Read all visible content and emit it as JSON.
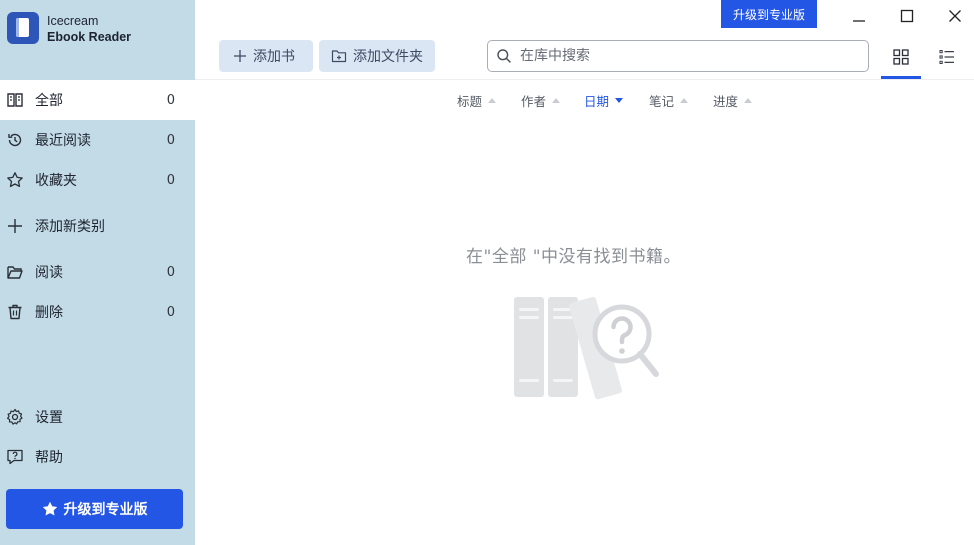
{
  "app": {
    "name_line1": "Icecream",
    "name_line2": "Ebook Reader"
  },
  "sidebar": {
    "items": [
      {
        "label": "全部",
        "count": "0",
        "icon": "book-open-icon",
        "active": true
      },
      {
        "label": "最近阅读",
        "count": "0",
        "icon": "history-icon"
      },
      {
        "label": "收藏夹",
        "count": "0",
        "icon": "star-icon"
      },
      {
        "label": "添加新类别",
        "icon": "plus-icon"
      },
      {
        "label": "阅读",
        "count": "0",
        "icon": "folder-open-icon"
      },
      {
        "label": "删除",
        "count": "0",
        "icon": "trash-icon"
      }
    ],
    "bottom": [
      {
        "label": "设置",
        "icon": "gear-icon"
      },
      {
        "label": "帮助",
        "icon": "help-icon"
      }
    ],
    "upgrade_label": "升级到专业版"
  },
  "toolbar": {
    "add_book_label": "添加书",
    "add_folder_label": "添加文件夹",
    "search_placeholder": "在库中搜索"
  },
  "top_upgrade_label": "升级到专业版",
  "sort_columns": [
    {
      "label": "标题",
      "active": false
    },
    {
      "label": "作者",
      "active": false
    },
    {
      "label": "日期",
      "active": true
    },
    {
      "label": "笔记",
      "active": false
    },
    {
      "label": "进度",
      "active": false
    }
  ],
  "empty_message": "在\"全部 \"中没有找到书籍。",
  "colors": {
    "accent": "#2456e6",
    "sidebar_bg": "#c2dbe6",
    "button_bg": "#dbe6f5"
  }
}
